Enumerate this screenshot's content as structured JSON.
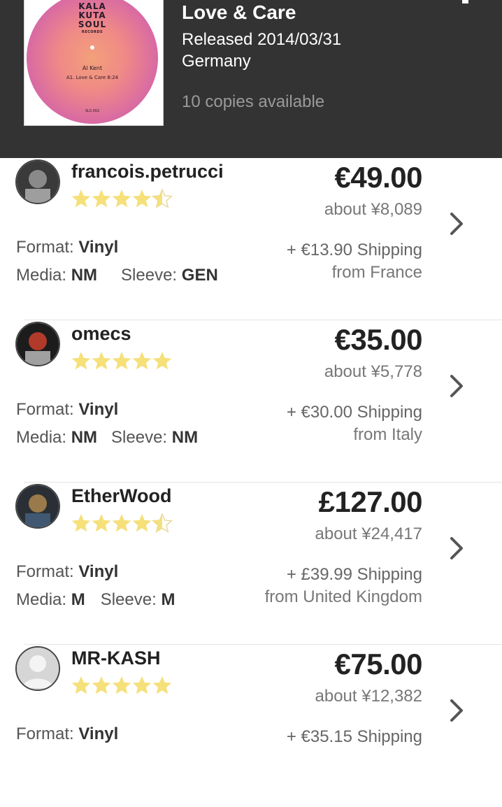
{
  "release": {
    "title": "Love & Care",
    "released": "Released 2014/03/31",
    "country": "Germany",
    "copies": "10 copies available",
    "cover": {
      "brand_line1": "KALA",
      "brand_line2": "KUTA",
      "brand_line3": "SOUL",
      "brand_line4": "RECORDS",
      "artist": "Al Kent",
      "track": "A1. Love & Care    8:24",
      "catalog": "SLS 002"
    }
  },
  "labels": {
    "format": "Format:",
    "media": "Media:",
    "sleeve": "Sleeve:"
  },
  "listings": [
    {
      "seller": "francois.petrucci",
      "rating": 4.5,
      "price": "€49.00",
      "approx": "about ¥8,089",
      "format": "Vinyl",
      "media": "NM",
      "sleeve": "GEN",
      "shipping": "+ €13.90 Shipping",
      "from": "from France"
    },
    {
      "seller": "omecs",
      "rating": 5,
      "price": "€35.00",
      "approx": "about ¥5,778",
      "format": "Vinyl",
      "media": "NM",
      "sleeve": "NM",
      "shipping": "+ €30.00 Shipping",
      "from": "from Italy"
    },
    {
      "seller": "EtherWood",
      "rating": 4.5,
      "price": "£127.00",
      "approx": "about ¥24,417",
      "format": "Vinyl",
      "media": "M",
      "sleeve": "M",
      "shipping": "+ £39.99 Shipping",
      "from": "from United Kingdom"
    },
    {
      "seller": "MR-KASH",
      "rating": 5,
      "price": "€75.00",
      "approx": "about ¥12,382",
      "format": "Vinyl",
      "shipping": "+ €35.15 Shipping"
    }
  ],
  "colors": {
    "header_bg": "#333333",
    "star_fill": "#f5e07a",
    "star_outline": "#e8d9a0",
    "chevron": "#555555"
  }
}
